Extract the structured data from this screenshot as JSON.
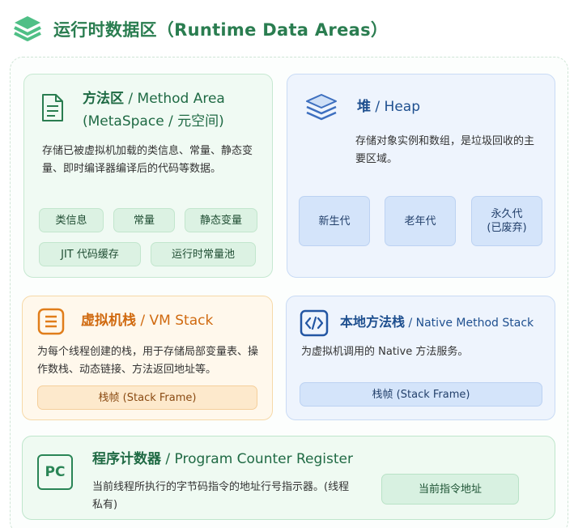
{
  "header": {
    "title": "运行时数据区（Runtime Data Areas）",
    "icon": "layers-icon"
  },
  "method_area": {
    "title_cn": "方法区",
    "title_en": " / Method Area",
    "subtitle": "(MetaSpace / 元空间)",
    "desc": "存储已被虚拟机加载的类信息、常量、静态变量、即时编译器编译后的代码等数据。",
    "chips": [
      "类信息",
      "常量",
      "静态变量",
      "JIT 代码缓存",
      "运行时常量池"
    ],
    "icon": "document-icon"
  },
  "heap": {
    "title_cn": "堆",
    "title_en": " / Heap",
    "desc": "存储对象实例和数组，是垃圾回收的主要区域。",
    "chips": [
      "新生代",
      "老年代",
      "永久代\n(已废弃)"
    ],
    "icon": "layers-icon"
  },
  "vm_stack": {
    "title_cn": "虚拟机栈",
    "title_en": " / VM Stack",
    "desc": "为每个线程创建的栈，用于存储局部变量表、操作数栈、动态链接、方法返回地址等。",
    "chip": "栈帧 (Stack Frame)",
    "icon": "list-icon"
  },
  "native_stack": {
    "title_cn": "本地方法栈",
    "title_en": " / Native Method Stack",
    "desc": "为虚拟机调用的 Native 方法服务。",
    "chip": "栈帧 (Stack Frame)",
    "icon": "code-icon"
  },
  "pc_register": {
    "title_cn": "程序计数器",
    "title_en": " / Program Counter Register",
    "desc": "当前线程所执行的字节码指令的地址行号指示器。(线程私有)",
    "chip": "当前指令地址",
    "icon_label": "PC",
    "icon": "pc-icon"
  },
  "colors": {
    "green": "#2a7d50",
    "blue": "#1e4f8f",
    "orange": "#e07d1a",
    "heap_icon": "#3d6fbf"
  }
}
